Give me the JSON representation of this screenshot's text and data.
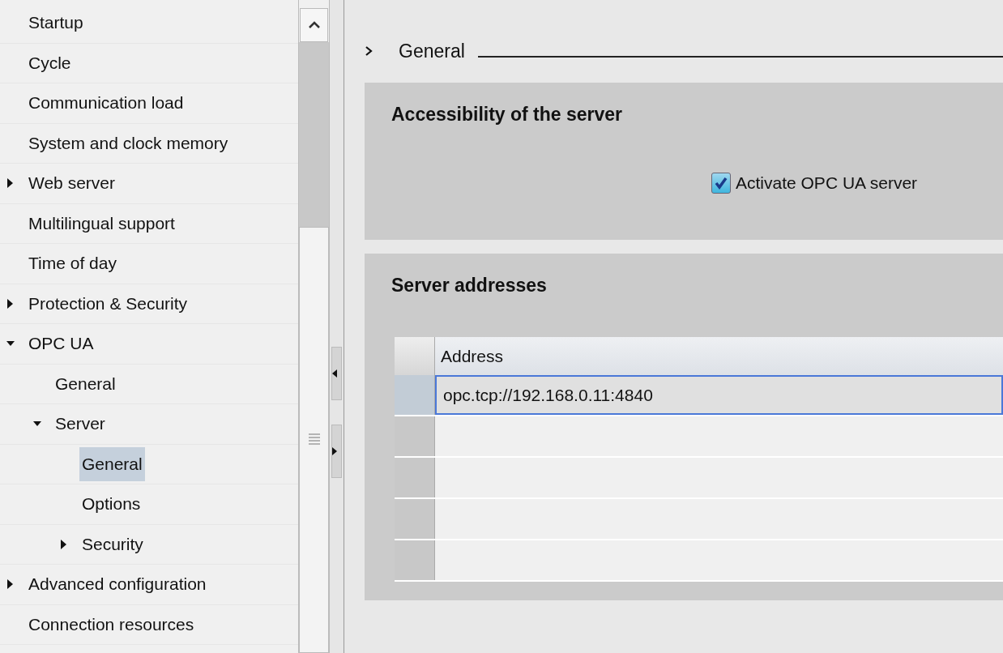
{
  "tree": {
    "items": [
      {
        "label": "Startup",
        "selected": false
      },
      {
        "label": "Cycle",
        "selected": false
      },
      {
        "label": "Communication load",
        "selected": false
      },
      {
        "label": "System and clock memory",
        "selected": false
      },
      {
        "label": "Web server",
        "selected": false,
        "expanded": false
      },
      {
        "label": "Multilingual support",
        "selected": false
      },
      {
        "label": "Time of day",
        "selected": false
      },
      {
        "label": "Protection & Security",
        "selected": false,
        "expanded": false
      },
      {
        "label": "OPC UA",
        "selected": false,
        "expanded": true,
        "children": [
          {
            "label": "General",
            "selected": false
          },
          {
            "label": "Server",
            "selected": false,
            "expanded": true,
            "children": [
              {
                "label": "General",
                "selected": true
              },
              {
                "label": "Options",
                "selected": false
              },
              {
                "label": "Security",
                "selected": false,
                "expanded": false
              }
            ]
          }
        ]
      },
      {
        "label": "Advanced configuration",
        "selected": false,
        "expanded": false
      },
      {
        "label": "Connection resources",
        "selected": false
      }
    ]
  },
  "section": {
    "title": "General"
  },
  "accessibility": {
    "title": "Accessibility of the server",
    "activate_opc_ua": {
      "label": "Activate OPC UA server",
      "checked": true
    }
  },
  "server_addresses": {
    "title": "Server addresses",
    "table": {
      "columns": [
        "Address"
      ],
      "rows": [
        {
          "address": "opc.tcp://192.168.0.11:4840",
          "selected": true
        }
      ]
    }
  }
}
